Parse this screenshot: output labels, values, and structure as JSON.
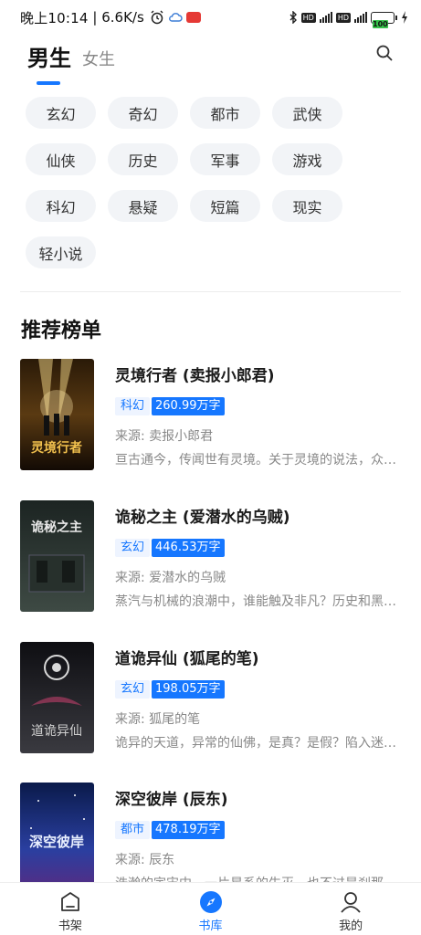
{
  "status": {
    "time": "晚上10:14",
    "speed": "6.6K/s",
    "battery": "100"
  },
  "tabs": {
    "male": "男生",
    "female": "女生"
  },
  "genres": [
    "玄幻",
    "奇幻",
    "都市",
    "武侠",
    "仙侠",
    "历史",
    "军事",
    "游戏",
    "科幻",
    "悬疑",
    "短篇",
    "现实",
    "轻小说"
  ],
  "section_title": "推荐榜单",
  "books": [
    {
      "title": "灵境行者 (卖报小郎君)",
      "genre": "科幻",
      "words": "260.99万字",
      "source": "来源: 卖报小郎君",
      "desc": "亘古通今，传闻世有灵境。关于灵境的说法，众说纷纭",
      "cover_text": "灵境行者"
    },
    {
      "title": "诡秘之主 (爱潜水的乌贼)",
      "genre": "玄幻",
      "words": "446.53万字",
      "source": "来源: 爱潜水的乌贼",
      "desc": "蒸汽与机械的浪潮中，谁能触及非凡？历史和黑暗的迷雾",
      "cover_text": "诡秘之主"
    },
    {
      "title": "道诡异仙 (狐尾的笔)",
      "genre": "玄幻",
      "words": "198.05万字",
      "source": "来源: 狐尾的笔",
      "desc": "诡异的天道，异常的仙佛，是真？是假？陷入迷惘的李火旺",
      "cover_text": "道诡异仙"
    },
    {
      "title": "深空彼岸 (辰东)",
      "genre": "都市",
      "words": "478.19万字",
      "source": "来源: 辰东",
      "desc": "浩瀚的宇宙中，一片星系的生灭，也不过是刹那的斑驳流光",
      "cover_text": "深空彼岸"
    }
  ],
  "nav": {
    "shelf": "书架",
    "library": "书库",
    "mine": "我的"
  }
}
